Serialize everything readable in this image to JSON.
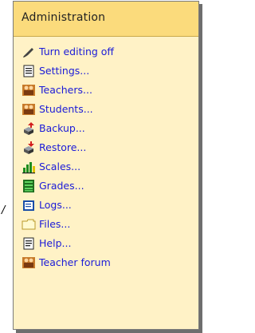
{
  "block": {
    "title": "Administration",
    "items": [
      {
        "label": "Turn editing off",
        "icon": "pencil-icon"
      },
      {
        "label": "Settings...",
        "icon": "settings-icon"
      },
      {
        "label": "Teachers...",
        "icon": "teachers-icon"
      },
      {
        "label": "Students...",
        "icon": "students-icon"
      },
      {
        "label": "Backup...",
        "icon": "backup-icon"
      },
      {
        "label": "Restore...",
        "icon": "restore-icon"
      },
      {
        "label": "Scales...",
        "icon": "scales-icon"
      },
      {
        "label": "Grades...",
        "icon": "grades-icon"
      },
      {
        "label": "Logs...",
        "icon": "logs-icon"
      },
      {
        "label": "Files...",
        "icon": "folder-icon"
      },
      {
        "label": "Help...",
        "icon": "help-icon"
      },
      {
        "label": "Teacher forum",
        "icon": "forum-icon"
      }
    ]
  },
  "stray_text": "/",
  "colors": {
    "header_bg": "#fbdb7c",
    "panel_bg": "#fff2c6",
    "link": "#1b1bd8"
  }
}
